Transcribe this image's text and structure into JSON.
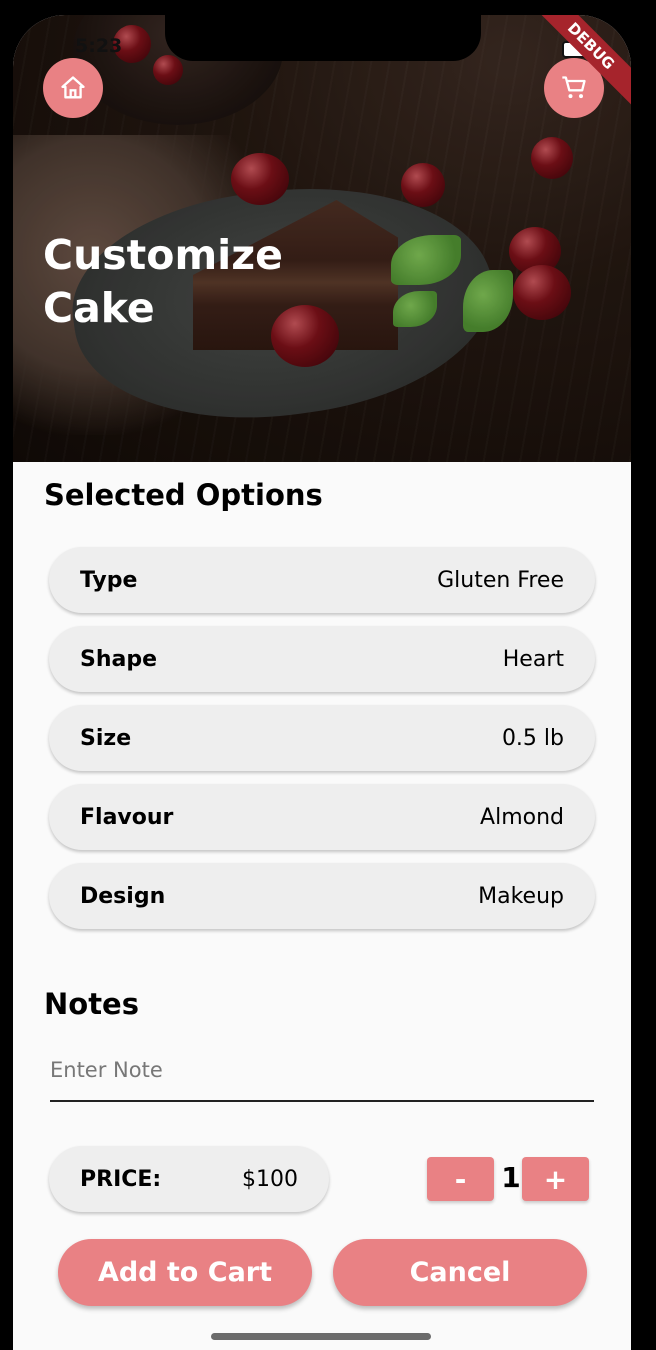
{
  "status_bar": {
    "time": "5:23"
  },
  "debug_banner": "DEBUG",
  "header": {
    "title_line1": "Customize",
    "title_line2": "Cake",
    "home_icon": "home-icon",
    "cart_icon": "cart-icon"
  },
  "selected_options": {
    "title": "Selected Options",
    "rows": [
      {
        "label": "Type",
        "value": "Gluten Free"
      },
      {
        "label": "Shape",
        "value": "Heart"
      },
      {
        "label": "Size",
        "value": "0.5 lb"
      },
      {
        "label": "Flavour",
        "value": "Almond"
      },
      {
        "label": "Design",
        "value": "Makeup"
      }
    ]
  },
  "notes": {
    "title": "Notes",
    "placeholder": "Enter Note",
    "value": ""
  },
  "price": {
    "label": "PRICE:",
    "value": "$100"
  },
  "quantity": {
    "minus_label": "-",
    "value": "1",
    "plus_label": "+"
  },
  "actions": {
    "add_to_cart": "Add to Cart",
    "cancel": "Cancel"
  },
  "colors": {
    "accent": "#e98184",
    "row_bg": "#eeeeee",
    "page_bg": "#fafafa"
  }
}
